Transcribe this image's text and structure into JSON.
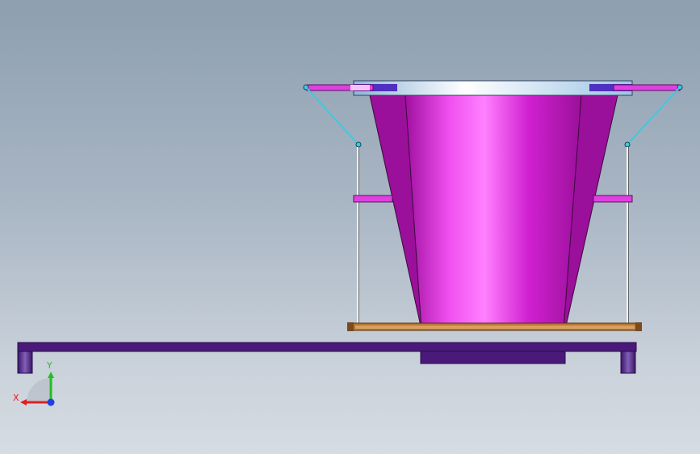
{
  "viewport": {
    "background_top": "#8d9fb0",
    "background_bottom": "#d6dce3"
  },
  "model": {
    "hopper_color": "#d020d0",
    "hopper_highlight": "#ff60ff",
    "frame_color": "#4a1a7a",
    "link_color": "#40c8e0",
    "tray_color": "#b87830",
    "flange_color": "#c8ecff",
    "bar_color": "#e040e0"
  },
  "triad": {
    "x_label": "X",
    "y_label": "Y",
    "x_color": "#e02020",
    "y_color": "#20c020",
    "z_color": "#2040e0"
  }
}
